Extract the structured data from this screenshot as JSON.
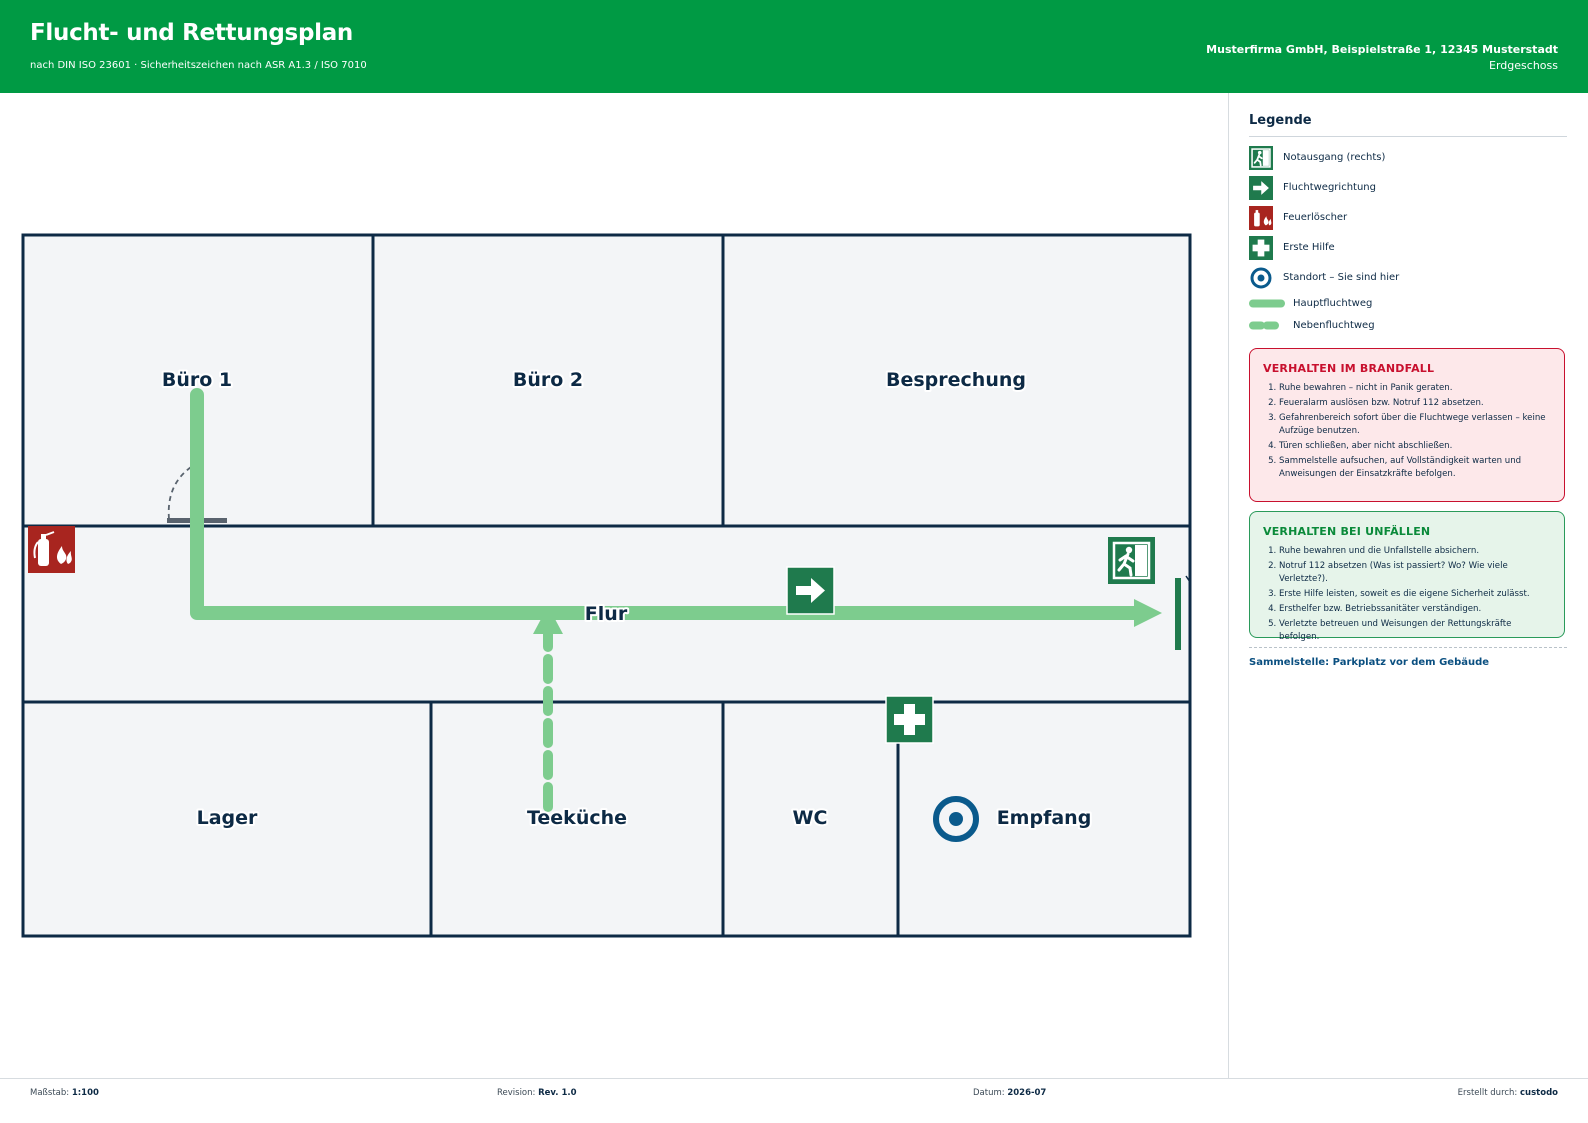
{
  "header": {
    "title": "Flucht- und Rettungsplan",
    "subtitle": "nach DIN ISO 23601 · Sicherheitszeichen nach ASR A1.3 / ISO 7010",
    "company": "Musterfirma GmbH, Beispielstraße 1, 12345 Musterstadt",
    "floor": "Erdgeschoss"
  },
  "plan": {
    "rooms": {
      "buero1": "Büro 1",
      "buero2": "Büro 2",
      "besprechung": "Besprechung",
      "flur": "Flur",
      "lager": "Lager",
      "teekueche": "Teeküche",
      "wc": "WC",
      "empfang": "Empfang"
    },
    "colors": {
      "wall": "#0d2a45",
      "room_fill": "#f3f5f7",
      "main_route": "#7dcc8e",
      "sign_green": "#1f7a4d",
      "sign_red": "#a8251f",
      "you_are_here": "#0a5a8c"
    },
    "icons": [
      "fire-extinguisher-icon",
      "direction-arrow-icon",
      "emergency-exit-icon",
      "first-aid-icon",
      "you-are-here-icon"
    ]
  },
  "legend": {
    "title": "Legende",
    "items": {
      "exit": "Notausgang (rechts)",
      "direction": "Fluchtwegrichtung",
      "extinguisher": "Feuerlöscher",
      "first_aid": "Erste Hilfe",
      "location": "Standort – Sie sind hier",
      "main_route": "Hauptfluchtweg",
      "secondary_route": "Nebenfluchtweg"
    }
  },
  "fire_box": {
    "title": "VERHALTEN IM BRANDFALL",
    "items": [
      "Ruhe bewahren – nicht in Panik geraten.",
      "Feueralarm auslösen bzw. Notruf 112 absetzen.",
      "Gefahrenbereich sofort über die Fluchtwege verlassen – keine Aufzüge benutzen.",
      "Türen schließen, aber nicht abschließen.",
      "Sammelstelle aufsuchen, auf Vollständigkeit warten und Anweisungen der Einsatzkräfte befolgen."
    ]
  },
  "accident_box": {
    "title": "VERHALTEN BEI UNFÄLLEN",
    "items": [
      "Ruhe bewahren und die Unfallstelle absichern.",
      "Notruf 112 absetzen (Was ist passiert? Wo? Wie viele Verletzte?).",
      "Erste Hilfe leisten, soweit es die eigene Sicherheit zulässt.",
      "Ersthelfer bzw. Betriebssanitäter verständigen.",
      "Verletzte betreuen und Weisungen der Rettungskräfte befolgen."
    ]
  },
  "assembly": "Sammelstelle: Parkplatz vor dem Gebäude",
  "footer": {
    "scale_label": "Maßstab:",
    "scale_value": "1:100",
    "revision_label": "Revision:",
    "revision_value": "Rev. 1.0",
    "date_label": "Datum:",
    "date_value": "2026-07",
    "author_label": "Erstellt durch:",
    "author_value": "custodo"
  }
}
